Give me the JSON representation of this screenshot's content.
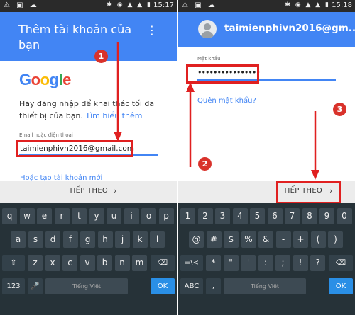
{
  "left": {
    "status": {
      "time": "15:17"
    },
    "title": "Thêm tài khoản của bạn",
    "logo": "Google",
    "description": "Hãy đăng nhập để khai thác tối đa thiết bị của bạn.",
    "learn_more": "Tìm hiểu thêm",
    "field_label": "Email hoặc điện thoại",
    "field_value": "taimienphivn2016@gmail.com",
    "create_account": "Hoặc tạo tài khoản mới",
    "next": "TIẾP THEO",
    "step": "1",
    "step2": "2"
  },
  "right": {
    "status": {
      "time": "15:18"
    },
    "email": "taimienphivn2016@gm...",
    "password_label": "Mật khẩu",
    "password_value": "••••••••••••••••",
    "forgot": "Quên mật khẩu?",
    "next": "TIẾP THEO",
    "step": "3"
  },
  "keyboard": {
    "row1": [
      "q",
      "w",
      "e",
      "r",
      "t",
      "y",
      "u",
      "i",
      "o",
      "p"
    ],
    "row2": [
      "a",
      "s",
      "d",
      "f",
      "g",
      "h",
      "j",
      "k",
      "l"
    ],
    "row3": [
      "z",
      "x",
      "c",
      "v",
      "b",
      "n",
      "m"
    ],
    "shift": "⇧",
    "delete": "⌫",
    "mode": "123",
    "space": "Tiếng Việt",
    "ok": "OK",
    "mic": "🎤"
  },
  "symbols": {
    "row1": [
      "1",
      "2",
      "3",
      "4",
      "5",
      "6",
      "7",
      "8",
      "9",
      "0"
    ],
    "row2": [
      "@",
      "#",
      "$",
      "%",
      "&",
      "-",
      "+",
      "(",
      ")"
    ],
    "row3": [
      "*",
      "\"",
      "'",
      ":",
      ";",
      "!",
      "?"
    ],
    "alt": "=\\<",
    "delete": "⌫",
    "abc": "ABC",
    "space": "Tiếng Việt",
    "ok": "OK",
    "comma": ","
  },
  "colors": {
    "accent": "#4285f4",
    "annotation": "#e02020",
    "keyboard_bg": "#263238"
  },
  "icons": {
    "menu": "kebab-menu-icon",
    "next": "chevron-right-icon",
    "avatar": "account-circle-icon"
  }
}
